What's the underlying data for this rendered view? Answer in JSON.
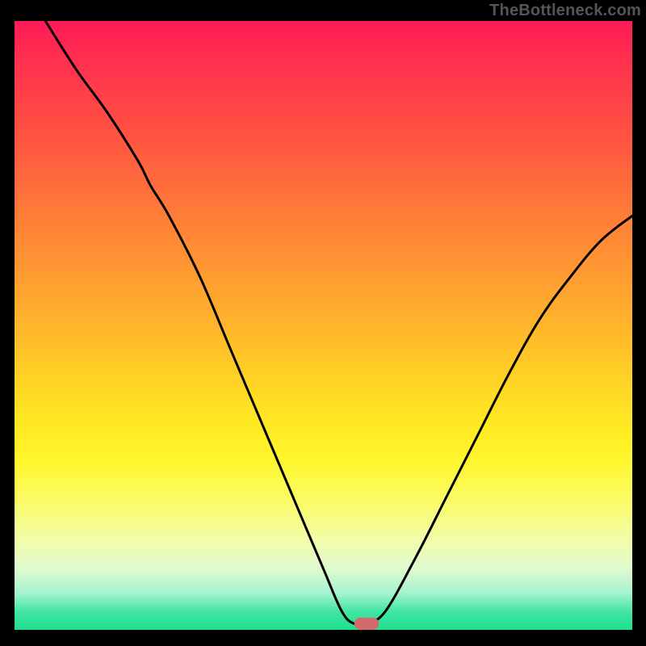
{
  "watermark": "TheBottleneck.com",
  "chart_data": {
    "type": "line",
    "title": "",
    "xlabel": "",
    "ylabel": "",
    "xlim": [
      0,
      100
    ],
    "ylim": [
      0,
      100
    ],
    "background_gradient": {
      "top": "#ff1a57",
      "middle": "#ffe823",
      "bottom": "#1fe08f"
    },
    "series": [
      {
        "name": "left",
        "x": [
          5,
          10,
          15,
          20,
          22,
          25,
          30,
          35,
          40,
          45,
          50,
          53,
          55,
          57
        ],
        "y": [
          100,
          92,
          85,
          77,
          73,
          68,
          58,
          46,
          34,
          22,
          10,
          3,
          1,
          1
        ]
      },
      {
        "name": "right",
        "x": [
          57,
          60,
          65,
          70,
          75,
          80,
          85,
          90,
          95,
          100
        ],
        "y": [
          1,
          3,
          12,
          22,
          32,
          42,
          51,
          58,
          64,
          68
        ]
      }
    ],
    "marker": {
      "x": 57,
      "y": 1,
      "width_units": 4,
      "height_units": 2
    }
  }
}
